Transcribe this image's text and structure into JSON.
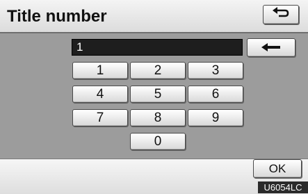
{
  "header": {
    "title": "Title number",
    "back_icon": "return-arrow-icon"
  },
  "input": {
    "value": "1",
    "delete_icon": "left-arrow-icon"
  },
  "keypad": {
    "keys": [
      "1",
      "2",
      "3",
      "4",
      "5",
      "6",
      "7",
      "8",
      "9",
      "0"
    ]
  },
  "footer": {
    "ok_label": "OK"
  },
  "image_code": "U6054LC"
}
